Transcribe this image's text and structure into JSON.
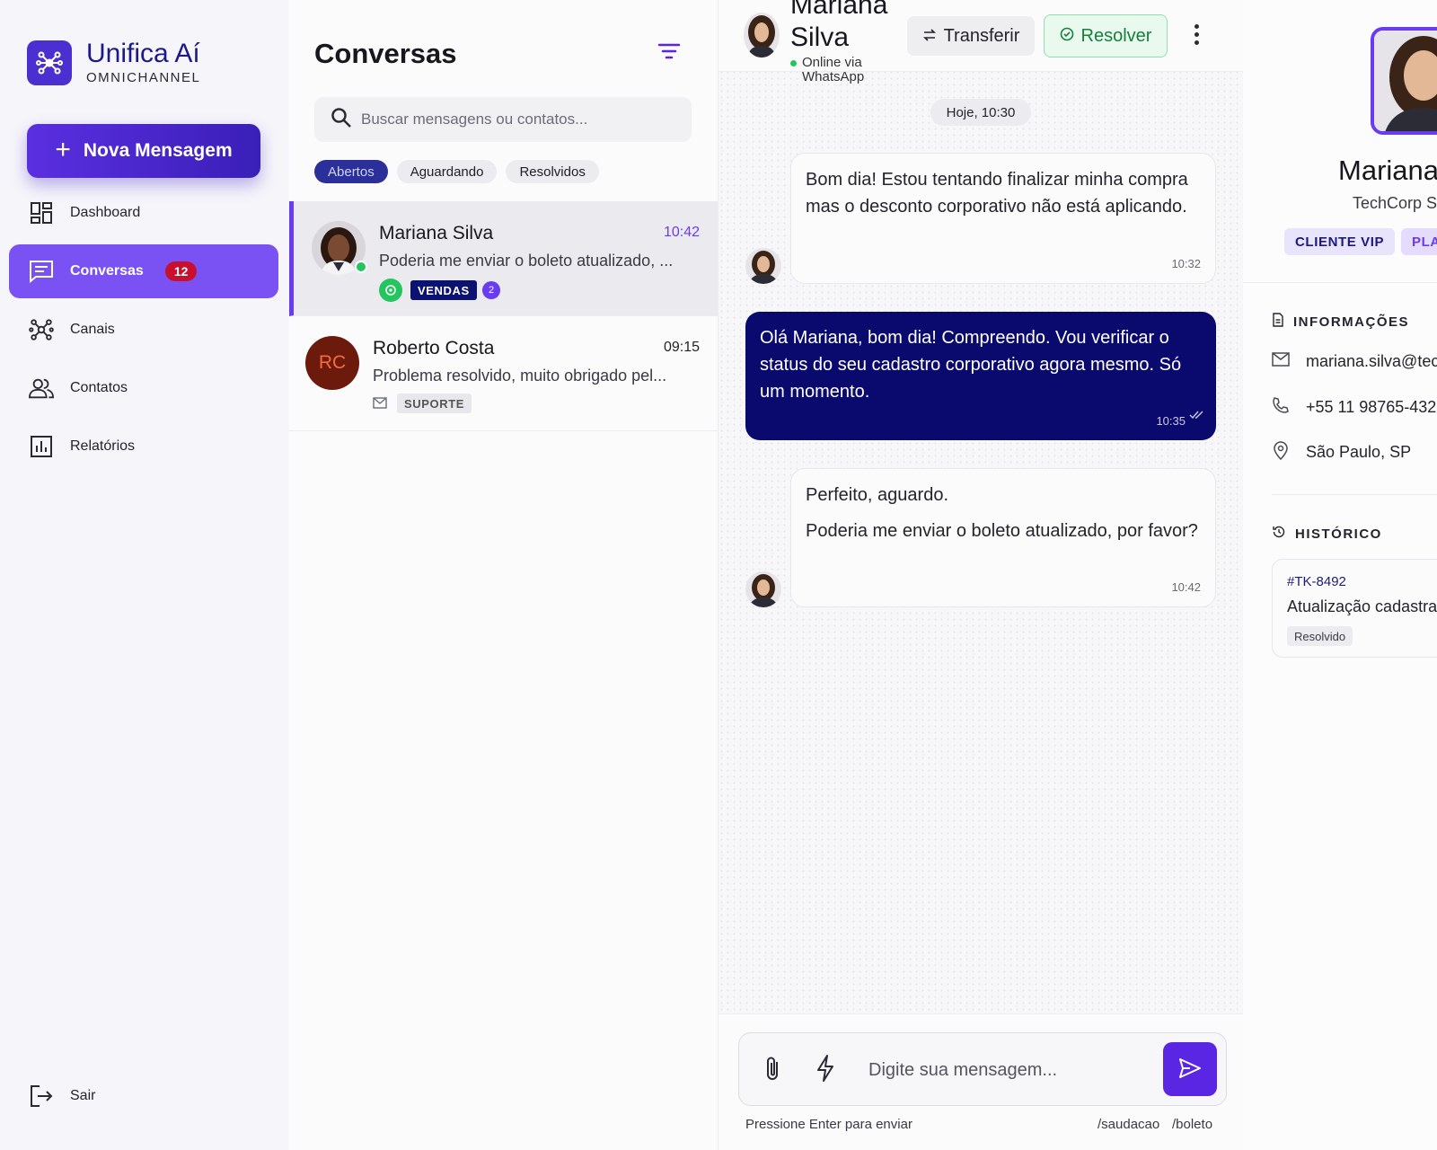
{
  "brand": {
    "name": "Unifica Aí",
    "tagline": "OMNICHANNEL",
    "accent": "#6a3cef"
  },
  "sidebar": {
    "new_message_label": "Nova Mensagem",
    "items": [
      {
        "label": "Dashboard",
        "icon": "dashboard-icon"
      },
      {
        "label": "Conversas",
        "icon": "chat-icon",
        "badge": "12",
        "active": true
      },
      {
        "label": "Canais",
        "icon": "channels-icon"
      },
      {
        "label": "Contatos",
        "icon": "contacts-icon"
      },
      {
        "label": "Relatórios",
        "icon": "reports-icon"
      }
    ],
    "logout_label": "Sair"
  },
  "conversations": {
    "title": "Conversas",
    "search_placeholder": "Buscar mensagens ou contatos...",
    "filters": [
      "Abertos",
      "Aguardando",
      "Resolvidos"
    ],
    "active_filter": "Abertos",
    "items": [
      {
        "name": "Mariana Silva",
        "time": "10:42",
        "preview": "Poderia me enviar o boleto atualizado, ...",
        "channel": "whatsapp",
        "tag": "VENDAS",
        "unread": "2",
        "selected": true,
        "online": true
      },
      {
        "name": "Roberto Costa",
        "initials": "RC",
        "time": "09:15",
        "preview": "Problema resolvido, muito obrigado pel...",
        "channel": "email",
        "tag": "SUPORTE"
      }
    ]
  },
  "chat": {
    "contact_name": "Mariana Silva",
    "status": "Online via WhatsApp",
    "transfer_label": "Transferir",
    "resolve_label": "Resolver",
    "date_label": "Hoje, 10:30",
    "messages": [
      {
        "direction": "in",
        "text": "Bom dia! Estou tentando finalizar minha compra mas o desconto corporativo não está aplicando.",
        "time": "10:32"
      },
      {
        "direction": "out",
        "text": "Olá Mariana, bom dia! Compreendo. Vou verificar o status do seu cadastro corporativo agora mesmo. Só um momento.",
        "time": "10:35"
      },
      {
        "direction": "in",
        "text": "Perfeito, aguardo.",
        "text2": "Poderia me enviar o boleto atualizado, por favor?",
        "time": "10:42"
      }
    ],
    "composer_placeholder": "Digite sua mensagem...",
    "hint": "Pressione Enter para enviar",
    "shortcuts": [
      "/saudacao",
      "/boleto"
    ]
  },
  "profile": {
    "name": "Mariana",
    "company": "TechCorp S",
    "tags": [
      "CLIENTE VIP",
      "PLA"
    ],
    "info_title": "INFORMAÇÕES",
    "email": "mariana.silva@tec",
    "phone": "+55 11 98765-432",
    "location": "São Paulo, SP",
    "history_title": "HISTÓRICO",
    "ticket_id": "#TK-8492",
    "ticket_title": "Atualização cadastra",
    "ticket_status": "Resolvido"
  }
}
